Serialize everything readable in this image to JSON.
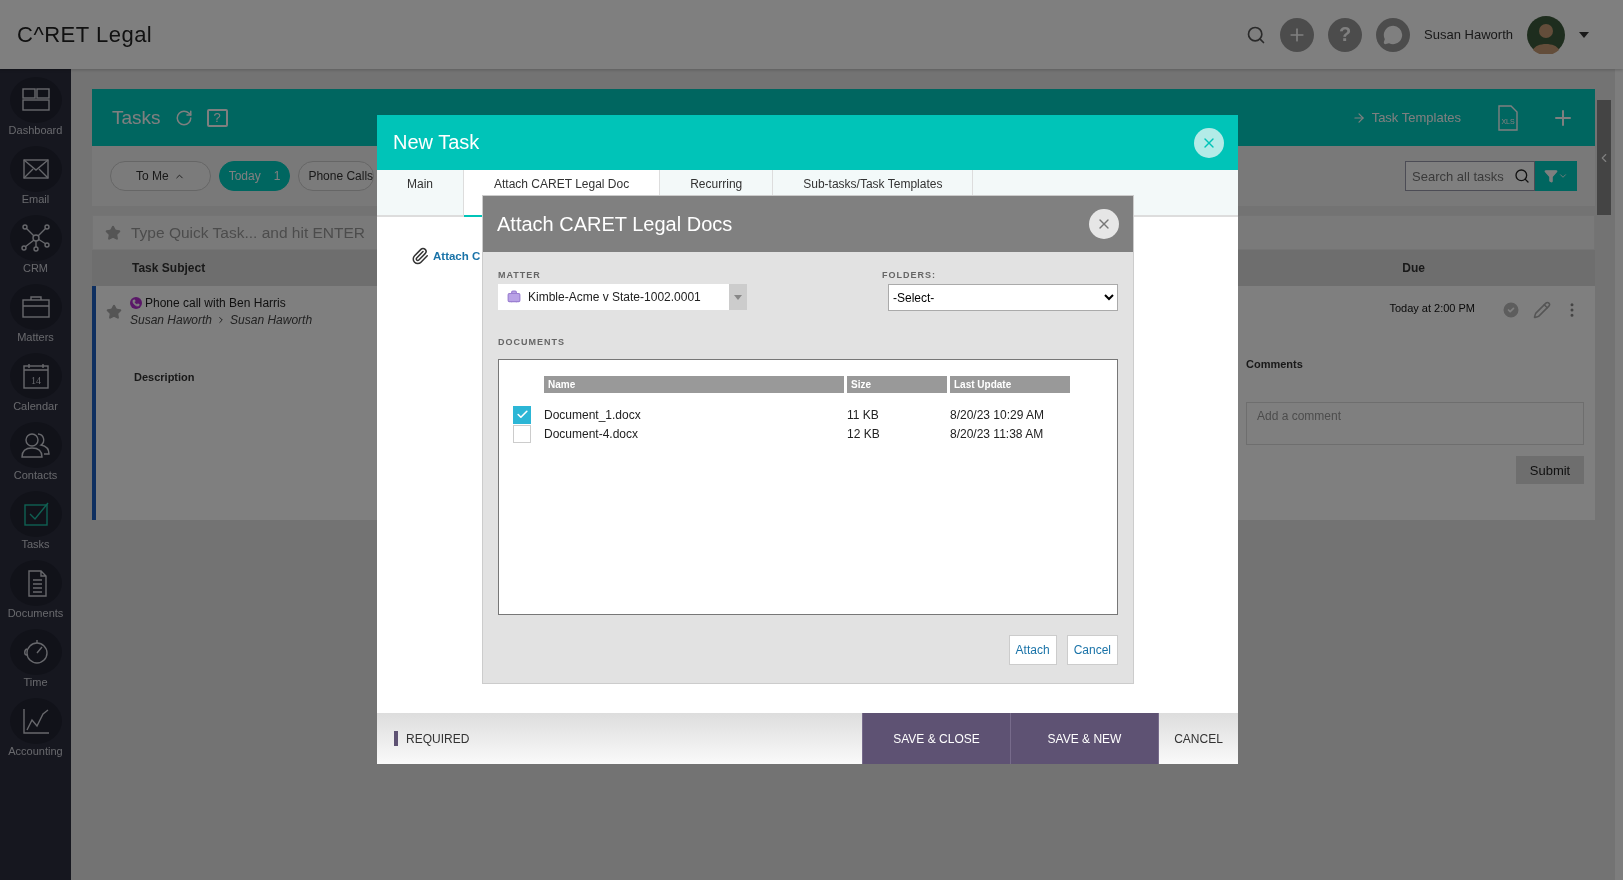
{
  "topbar": {
    "logo": "C^RET Legal",
    "user_name": "Susan Haworth",
    "help_label": "?"
  },
  "sidebar": [
    {
      "label": "Dashboard",
      "selected": false
    },
    {
      "label": "Email",
      "selected": false
    },
    {
      "label": "CRM",
      "selected": false
    },
    {
      "label": "Matters",
      "selected": false
    },
    {
      "label": "Calendar",
      "selected": false,
      "icon_text": "14"
    },
    {
      "label": "Contacts",
      "selected": false
    },
    {
      "label": "Tasks",
      "selected": true
    },
    {
      "label": "Documents",
      "selected": false
    },
    {
      "label": "Time",
      "selected": false
    },
    {
      "label": "Accounting",
      "selected": false
    }
  ],
  "tasks_panel": {
    "title": "Tasks",
    "help_label": "?",
    "templates_link": "Task Templates",
    "export_label": "XLS",
    "filters": [
      {
        "label": "To Me",
        "selected": false
      },
      {
        "label": "Today",
        "count": "1",
        "selected": true
      },
      {
        "label": "Phone Calls",
        "selected": false
      }
    ],
    "search_placeholder": "Search all tasks",
    "quick_task_placeholder": "Type Quick Task... and hit ENTER",
    "columns": [
      "Task Subject",
      "Due"
    ],
    "task": {
      "subject": "Phone call with Ben Harris",
      "from": "Susan Haworth",
      "to": "Susan Haworth",
      "due": "Today at 2:00 PM",
      "description_label": "Description",
      "comments_label": "Comments",
      "comment_placeholder": "Add a comment",
      "submit": "Submit"
    }
  },
  "new_task": {
    "title": "New Task",
    "tabs": [
      {
        "label": "Main",
        "selected": false
      },
      {
        "label": "Attach CARET Legal Doc",
        "selected": true
      },
      {
        "label": "Recurring",
        "selected": false
      },
      {
        "label": "Sub-tasks/Task Templates",
        "selected": false
      }
    ],
    "attach_link": "Attach C",
    "required": "REQUIRED",
    "buttons": [
      "SAVE & CLOSE",
      "SAVE & NEW",
      "CANCEL"
    ]
  },
  "attach_dialog": {
    "title": "Attach CARET Legal Docs",
    "matter_label": "MATTER",
    "matter_value": "Kimble-Acme v State-1002.0001",
    "folders_label": "FOLDERS:",
    "folders_value": "-Select-",
    "documents_label": "DOCUMENTS",
    "columns": [
      "Name",
      "Size",
      "Last Update"
    ],
    "documents": [
      {
        "name": "Document_1.docx",
        "size": "11 KB",
        "updated": "8/20/23 10:29 AM",
        "checked": true
      },
      {
        "name": "Document-4.docx",
        "size": "12 KB",
        "updated": "8/20/23 11:38 AM",
        "checked": false
      }
    ],
    "buttons": [
      "Attach",
      "Cancel"
    ]
  }
}
